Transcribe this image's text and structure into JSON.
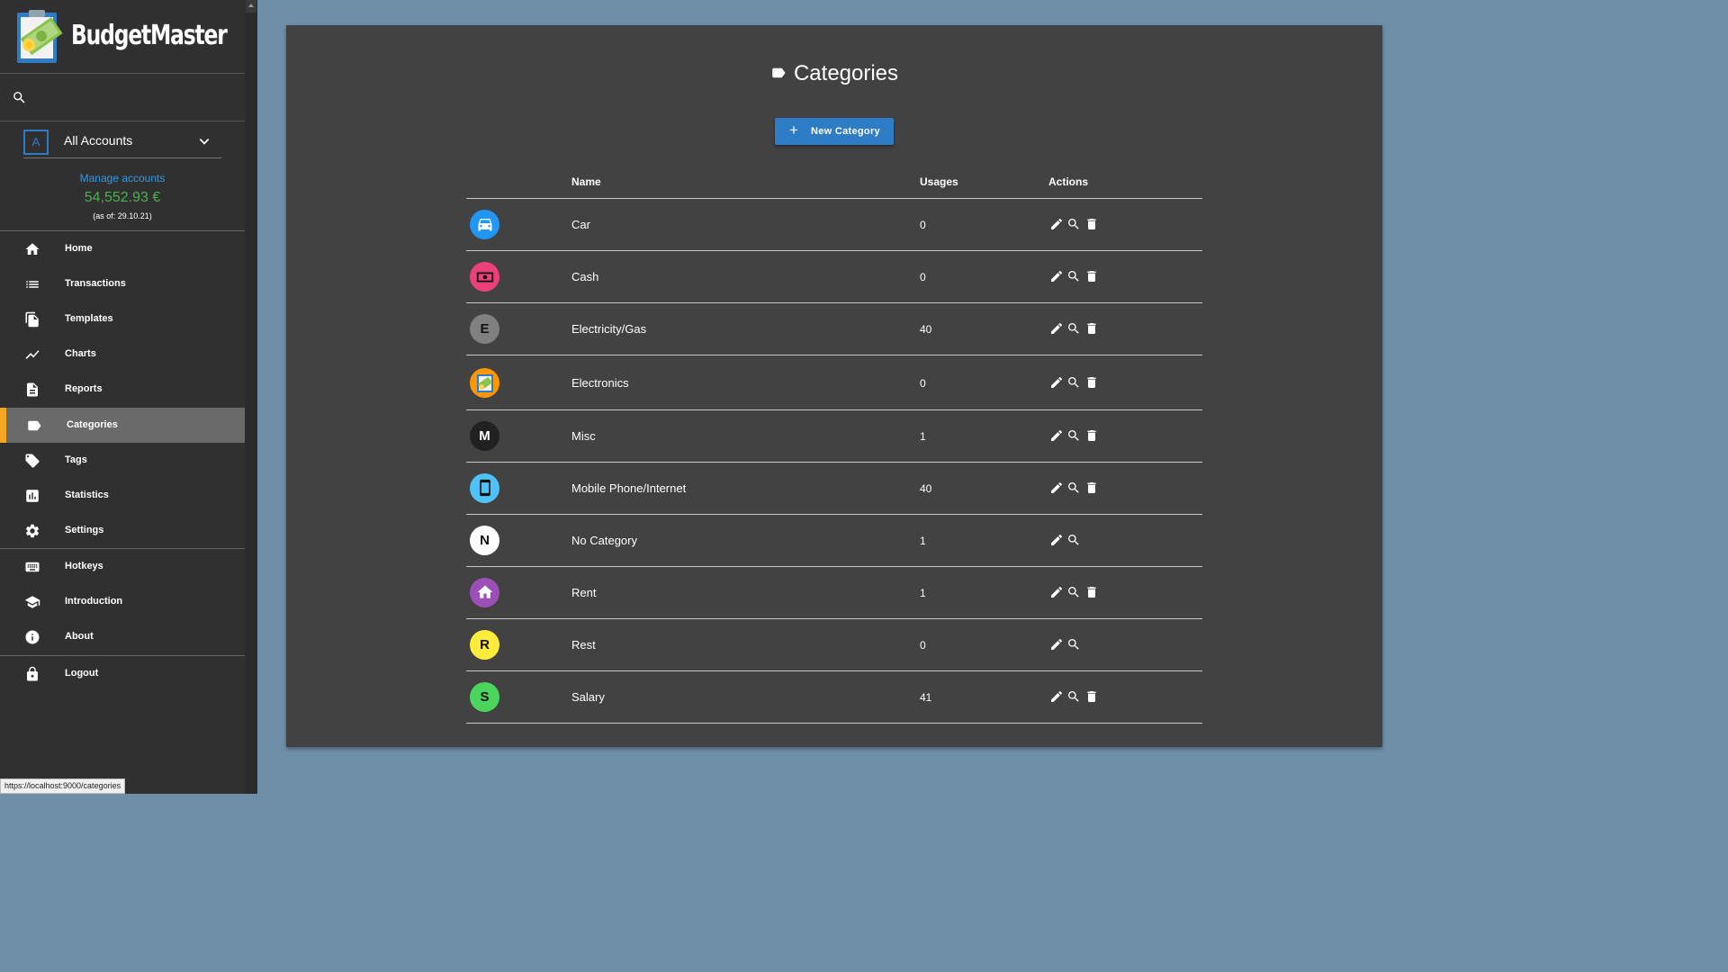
{
  "app": {
    "brand_name": "BudgetMaster",
    "status_url": "https://localhost:9000/categories"
  },
  "sidebar": {
    "account": {
      "badge": "A",
      "name": "All Accounts",
      "manage_label": "Manage accounts",
      "balance": "54,552.93 €",
      "as_of": "(as of: 29.10.21)"
    },
    "items": [
      {
        "label": "Home",
        "icon": "home-icon"
      },
      {
        "label": "Transactions",
        "icon": "list-icon"
      },
      {
        "label": "Templates",
        "icon": "file-copy-icon"
      },
      {
        "label": "Charts",
        "icon": "show-chart-icon"
      },
      {
        "label": "Reports",
        "icon": "description-icon"
      },
      {
        "label": "Categories",
        "icon": "label-icon",
        "active": true
      },
      {
        "label": "Tags",
        "icon": "local-offer-icon"
      },
      {
        "label": "Statistics",
        "icon": "assessment-icon"
      },
      {
        "label": "Settings",
        "icon": "settings-icon"
      },
      {
        "label": "Hotkeys",
        "icon": "keyboard-icon"
      },
      {
        "label": "Introduction",
        "icon": "school-icon"
      },
      {
        "label": "About",
        "icon": "info-icon"
      },
      {
        "label": "Logout",
        "icon": "lock-icon"
      }
    ]
  },
  "main": {
    "title": "Categories",
    "new_button": "New Category",
    "columns": {
      "name": "Name",
      "usages": "Usages",
      "actions": "Actions"
    },
    "rows": [
      {
        "name": "Car",
        "usages": "0",
        "color": "#2196f3",
        "icon": "car-icon",
        "letter": "",
        "deletable": true
      },
      {
        "name": "Cash",
        "usages": "0",
        "color": "#ec407a",
        "icon": "money-icon",
        "letter": "",
        "deletable": true
      },
      {
        "name": "Electricity/Gas",
        "usages": "40",
        "color": "#808080",
        "icon": "",
        "letter": "E",
        "deletable": true
      },
      {
        "name": "Electronics",
        "usages": "0",
        "color": "#ff9800",
        "icon": "custom-image-icon",
        "letter": "",
        "deletable": true
      },
      {
        "name": "Misc",
        "usages": "1",
        "color": "#212121",
        "icon": "",
        "letter": "M",
        "deletable": true
      },
      {
        "name": "Mobile Phone/Internet",
        "usages": "40",
        "color": "#4fc3f7",
        "icon": "smartphone-icon",
        "letter": "",
        "deletable": true
      },
      {
        "name": "No Category",
        "usages": "1",
        "color": "#ffffff",
        "icon": "",
        "letter": "N",
        "deletable": false
      },
      {
        "name": "Rent",
        "usages": "1",
        "color": "#9c4fb6",
        "icon": "house-icon",
        "letter": "",
        "deletable": true
      },
      {
        "name": "Rest",
        "usages": "0",
        "color": "#ffeb3b",
        "icon": "",
        "letter": "R",
        "deletable": false
      },
      {
        "name": "Salary",
        "usages": "41",
        "color": "#4cd55c",
        "icon": "",
        "letter": "S",
        "deletable": true
      }
    ]
  }
}
